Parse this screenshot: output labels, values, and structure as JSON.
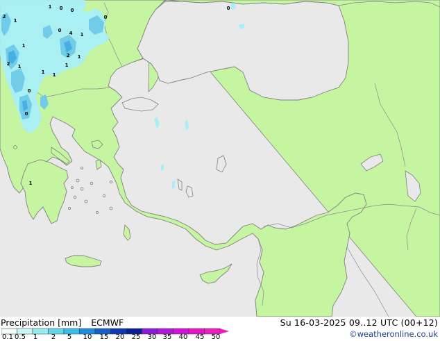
{
  "title": {
    "label": "Precipitation [mm]",
    "model": "ECMWF"
  },
  "valid_time": "Su 16-03-2025 09..12 UTC (00+12)",
  "credit": "©weatheronline.co.uk",
  "legend": {
    "ticks": [
      "0.1",
      "0.5",
      "1",
      "2",
      "5",
      "10",
      "15",
      "20",
      "25",
      "30",
      "35",
      "40",
      "45",
      "50"
    ],
    "colors": [
      "#f0fcfc",
      "#c6f6f6",
      "#96ecf0",
      "#64d6ec",
      "#3cbce8",
      "#1e8cdc",
      "#1460c8",
      "#0c38b0",
      "#062090",
      "#8c18d8",
      "#b018dc",
      "#d014d8",
      "#e414c8",
      "#ec20c0"
    ]
  },
  "colors": {
    "land": "#c6f5a2",
    "sea": "#e9e9e9",
    "coast": "#7f7f7f",
    "precip_light": "#a9eef6",
    "precip_medium": "#70cce9",
    "precip_heavy": "#49afe2"
  },
  "map": {
    "point_labels": [
      "1",
      "0",
      "0",
      "0",
      "0",
      "2",
      "1",
      "0",
      "4",
      "1",
      "1",
      "2",
      "1",
      "1",
      "1",
      "1",
      "1",
      "2",
      "0",
      "0",
      "1"
    ]
  }
}
